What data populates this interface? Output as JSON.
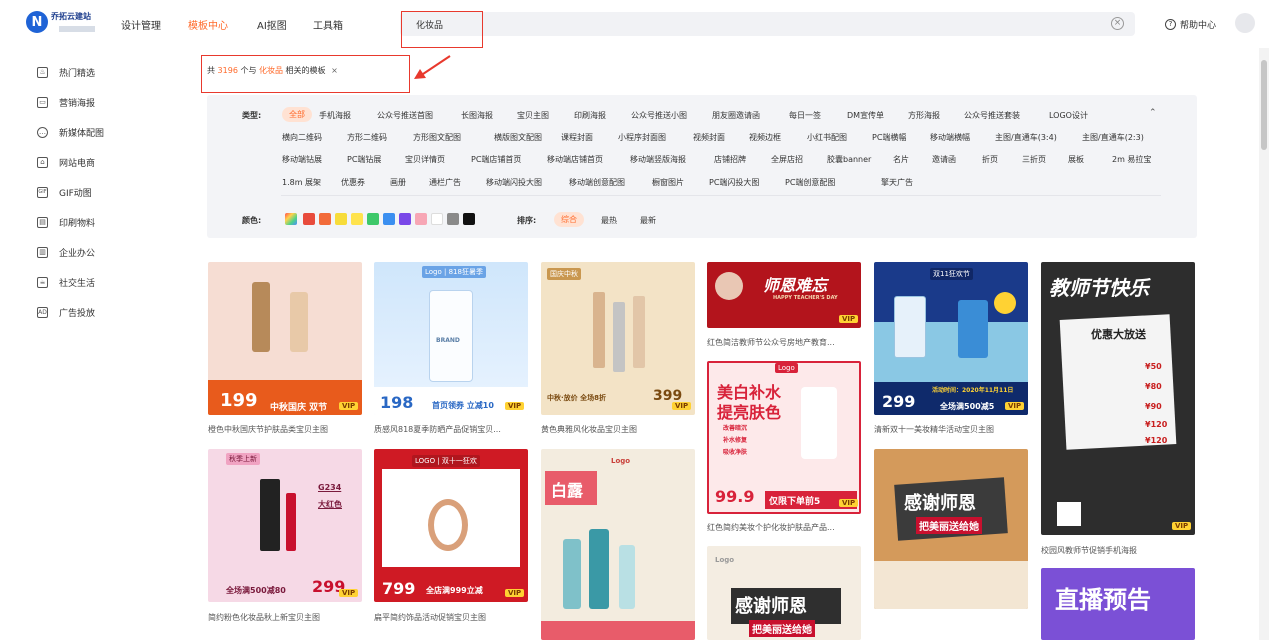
{
  "brand": {
    "name": "乔拓云建站"
  },
  "nav": [
    {
      "label": "设计管理"
    },
    {
      "label": "模板中心"
    },
    {
      "label": "AI抠图"
    },
    {
      "label": "工具箱"
    }
  ],
  "search": {
    "value": "化妆品"
  },
  "help": {
    "label": "帮助中心"
  },
  "sidebar": [
    {
      "label": "热门精选",
      "icon": "flame-icon"
    },
    {
      "label": "营销海报",
      "icon": "poster-icon"
    },
    {
      "label": "新媒体配图",
      "icon": "chat-icon"
    },
    {
      "label": "网站电商",
      "icon": "shop-icon"
    },
    {
      "label": "GIF动图",
      "icon": "gif-icon"
    },
    {
      "label": "印刷物料",
      "icon": "print-icon"
    },
    {
      "label": "企业办公",
      "icon": "briefcase-icon"
    },
    {
      "label": "社交生活",
      "icon": "cup-icon"
    },
    {
      "label": "广告投放",
      "icon": "ad-icon"
    }
  ],
  "result": {
    "prefix": "共",
    "count": "3196",
    "middle": "个与",
    "keyword": "化妆品",
    "suffix": "相关的模板",
    "close": "×"
  },
  "filter": {
    "type_label": "类型:",
    "types_row1": [
      "全部",
      "手机海报",
      "公众号推送首图",
      "长图海报",
      "宝贝主图",
      "印刷海报",
      "公众号推送小图",
      "朋友圈邀请函",
      "每日一签",
      "DM宣传单",
      "方形海报",
      "公众号推送套装",
      "LOGO设计"
    ],
    "types_row2": [
      "横向二维码",
      "方形二维码",
      "方形图文配图",
      "横版图文配图",
      "课程封面",
      "小程序封面图",
      "视频封面",
      "视频边框",
      "小红书配图",
      "PC端横幅",
      "移动端横幅",
      "主图/直通车(3:4)",
      "主图/直通车(2:3)"
    ],
    "types_row3": [
      "移动端钻展",
      "PC端钻展",
      "宝贝详情页",
      "PC端店铺首页",
      "移动端店铺首页",
      "移动端竖版海报",
      "店铺招牌",
      "全屏店招",
      "胶囊banner",
      "名片",
      "邀请函",
      "折页",
      "三折页",
      "展板",
      "2m 易拉宝"
    ],
    "types_row4": [
      "1.8m 展架",
      "优惠券",
      "画册",
      "通栏广告",
      "移动端闪投大图",
      "移动端创意配图",
      "橱窗图片",
      "PC端闪投大图",
      "PC端创意配图",
      "擎天广告"
    ],
    "color_label": "颜色:",
    "colors": [
      "#e84b3c",
      "#f26b3a",
      "#f7dc3a",
      "#ffe34d",
      "#3ec86a",
      "#3b8ff0",
      "#7a48e8",
      "#f7a6b5",
      "#ffffff",
      "#8a8a8a",
      "#111111"
    ],
    "sort_label": "排序:",
    "sorts": [
      "综合",
      "最热",
      "最新"
    ]
  },
  "cards": [
    {
      "caption": "橙色中秋国庆节护肤品类宝贝主图",
      "price": "199",
      "banner": "中秋国庆 双节",
      "vip": "VIP"
    },
    {
      "caption": "质感风818夏季防晒产品促销宝贝...",
      "price": "198",
      "banner": "首页领券 立减10",
      "top": "Logo | 818狂暑季",
      "brand": "BRAND",
      "vip": "VIP"
    },
    {
      "caption": "黄色典雅风化妆品宝贝主图",
      "price": "399",
      "banner": "中秋·放价 全场8折",
      "top": "国庆中秋",
      "vip": "VIP"
    },
    {
      "caption": "红色简洁教师节公众号房地产教育...",
      "title": "师恩难忘",
      "sub": "HAPPY TEACHER'S DAY",
      "vip": "VIP"
    },
    {
      "caption": "清新双十一美妆精华活动宝贝主图",
      "price": "299",
      "banner": "全场满500减5",
      "top": "双11狂欢节",
      "date": "活动时间：2020年11月11日",
      "vip": "VIP"
    },
    {
      "caption": "校园风教师节促销手机海报",
      "title": "教师节快乐",
      "sub": "优惠大放送",
      "lines": [
        "¥50",
        "¥80",
        "¥90",
        "¥120",
        "¥120"
      ],
      "vip": "VIP"
    },
    {
      "caption": "简约粉色化妆品秋上新宝贝主图",
      "price": "299",
      "banner": "全场满500减80",
      "code": "G234",
      "name": "大红色",
      "tag": "秋季上新",
      "vip": "VIP"
    },
    {
      "caption": "扁平简约饰品活动促销宝贝主图",
      "price": "799",
      "banner": "全店满999立减",
      "top": "LOGO | 双十一狂欢",
      "vip": "VIP"
    },
    {
      "caption": "",
      "title": "白露",
      "top": "Logo"
    },
    {
      "caption": "红色简约美妆个护化妆护肤品产品...",
      "title": "美白补水",
      "title2": "提亮肤色",
      "price": "99.9",
      "banner": "仅限下单前5",
      "top": "Logo",
      "lines": [
        "改善暗沉",
        "补水修复",
        "吸收净肤"
      ],
      "vip": "VIP"
    },
    {
      "caption": "",
      "title": "感谢师恩",
      "sub": "把美丽送给她"
    },
    {
      "caption": "",
      "title": "直播预告"
    },
    {
      "caption": "",
      "title": "感谢师恩",
      "sub": "把美丽送给她",
      "top": "Logo"
    }
  ]
}
